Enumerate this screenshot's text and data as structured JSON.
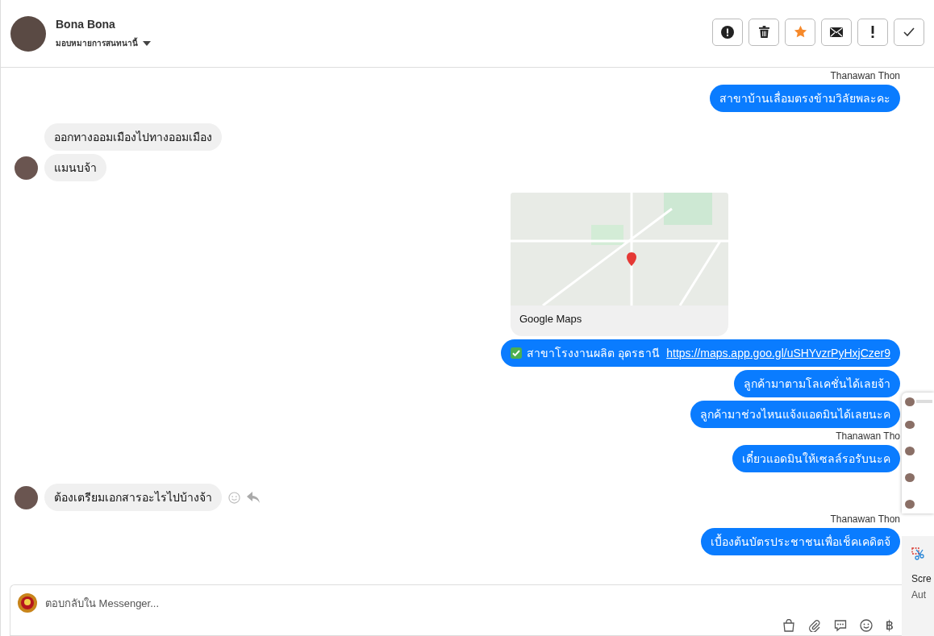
{
  "header": {
    "name": "Bona Bona",
    "assign_label": "มอบหมายการสนทนานี้"
  },
  "actions": [
    {
      "kind": "alert",
      "on": false
    },
    {
      "kind": "trash",
      "on": false
    },
    {
      "kind": "star",
      "on": true
    },
    {
      "kind": "mail",
      "on": false
    },
    {
      "kind": "exclaim",
      "on": false
    },
    {
      "kind": "check",
      "on": false
    }
  ],
  "messages": [
    {
      "kind": "sender",
      "text": "Thanawan Thon"
    },
    {
      "kind": "sent",
      "text": "สาขาบ้านเลื่อมตรงข้ามวิลัยพละคะ"
    },
    {
      "kind": "received",
      "avatar": false,
      "text": "ออกทางออมเมืองไปทางออมเมือง"
    },
    {
      "kind": "received",
      "avatar": true,
      "text": "แมนบจ้า"
    },
    {
      "kind": "map",
      "caption": "Google Maps"
    },
    {
      "kind": "link",
      "text": "สาขาโรงงานผลิต อุดรธานี",
      "link": "https://maps.app.goo.gl/uSHYvzrPyHxjCzer9"
    },
    {
      "kind": "sent",
      "text": "ลูกค้ามาตามโลเคชั่นได้เลยจ้า"
    },
    {
      "kind": "sent",
      "text": "ลูกค้ามาช่วงไหนแจ้งแอดมินได้เลยนะค"
    },
    {
      "kind": "sender",
      "text": "Thanawan Tho"
    },
    {
      "kind": "sent",
      "text": "เดี๋ยวแอดมินให้เซลล์รอรับนะค"
    },
    {
      "kind": "received",
      "avatar": true,
      "actions": true,
      "text": "ต้องเตรียมเอกสารอะไรไปบ้างจ้า"
    },
    {
      "kind": "sender",
      "text": "Thanawan Thon"
    },
    {
      "kind": "sent",
      "text": "เบื้องต้นบัตรประชาชนเพื่อเช็คเคดิตจ้"
    }
  ],
  "composer": {
    "placeholder": "ตอบกลับใน Messenger...",
    "currency": "฿"
  },
  "overlay": {
    "title": "Scre",
    "subtitle": "Aut"
  }
}
